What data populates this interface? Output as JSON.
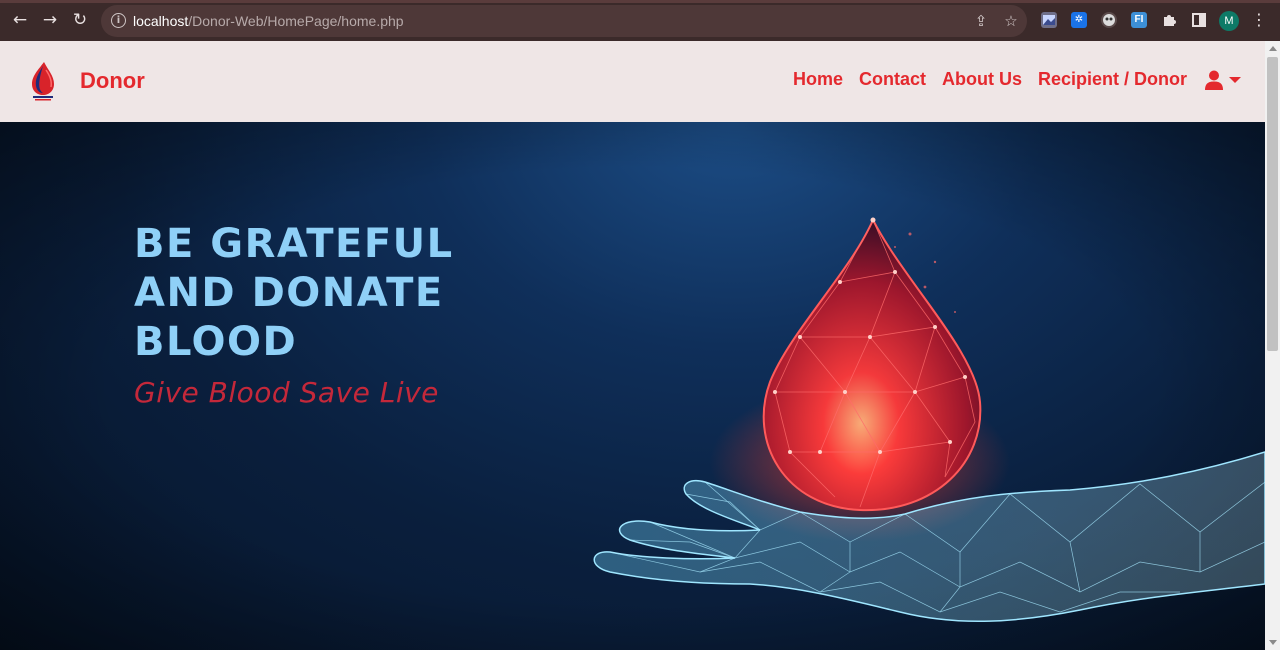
{
  "browser": {
    "url_host": "localhost",
    "url_path": "/Donor-Web/HomePage/home.php",
    "profile_initial": "M",
    "extensions": [
      "image-ext-icon",
      "settings-ext-icon",
      "mask-ext-icon",
      "fi-ext-icon"
    ],
    "fi_ext_label": "FI"
  },
  "navbar": {
    "brand": "Donor",
    "links": {
      "home": "Home",
      "contact": "Contact",
      "about": "About Us",
      "recipient_donor": "Recipient / Donor"
    },
    "user_icon": "user-icon"
  },
  "hero": {
    "headline_line1": "BE GRATEFUL",
    "headline_line2": "AND DONATE",
    "headline_line3": "BLOOD",
    "tagline": "Give Blood  Save Live"
  },
  "colors": {
    "brand_red": "#e4292e",
    "headline_blue": "#8fd0f7",
    "tagline_red": "#c4283a",
    "navbar_bg": "#efe6e6",
    "chrome_bg": "#3b2a2a"
  }
}
